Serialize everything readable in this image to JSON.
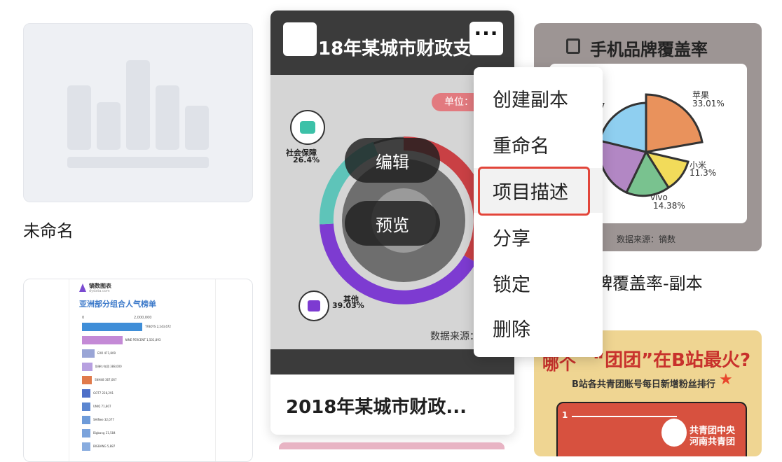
{
  "cards": {
    "untitled": {
      "title": "未命名"
    },
    "center": {
      "thumb_title": "18年某城市财政支",
      "unit_label": "单位：亿",
      "segment_social": {
        "label": "社会保障",
        "pct": "26.4%"
      },
      "segment_other": {
        "label": "其他",
        "pct": "39.03%"
      },
      "source": "数据来源：",
      "overlay_edit": "编辑",
      "overlay_preview": "预览",
      "title": "2018年某城市财政...",
      "more_label": "···"
    },
    "pie": {
      "header": "手机品牌覆盖率",
      "apple": {
        "label": "苹果",
        "pct": "33.01%"
      },
      "xiaomi": {
        "label": "小米",
        "pct": "11.3%"
      },
      "vivo": {
        "label": "vivo",
        "pct": "14.38%"
      },
      "left_partial": "7",
      "source": "数据来源：镝数",
      "title_partial": "牌覆盖率-副本"
    },
    "list": {
      "logo_text": "镝数图表",
      "logo_sub": "dydata.com",
      "heading": "亚洲部分组合人气榜单",
      "axis_start": "0",
      "axis_mid": "2,000,000",
      "rows": [
        {
          "label": "TFBOYS 2,243,672",
          "value": 2243672
        },
        {
          "label": "NINE PERCENT 1,501,893",
          "value": 1501893
        },
        {
          "label": "EXO 471,809",
          "value": 471809
        },
        {
          "label": "防弹少年团 388,000",
          "value": 388000
        },
        {
          "label": "SNH48 367,067",
          "value": 367067
        },
        {
          "label": "GOT7 228,291",
          "value": 228291
        },
        {
          "label": "UNIQ 71,807",
          "value": 71807
        },
        {
          "label": "SHINee 32,077",
          "value": 32077
        },
        {
          "label": "Bigbang 21,584",
          "value": 21584
        },
        {
          "label": "BIGBANG 5,887",
          "value": 5887
        }
      ]
    },
    "bili": {
      "title_left": "哪个",
      "title_main": "“团团”在B站最火?",
      "subtitle": "B站各共青团账号每日新增粉丝排行",
      "rank_one": "1",
      "badge_line1": "共青团中央",
      "badge_line2": "河南共青团"
    }
  },
  "menu": {
    "items": [
      "创建副本",
      "重命名",
      "项目描述",
      "分享",
      "锁定",
      "删除"
    ],
    "highlighted_index": 2
  },
  "colors": {
    "accent_red": "#e2453a",
    "menu_hl": "#f2f2f2"
  }
}
